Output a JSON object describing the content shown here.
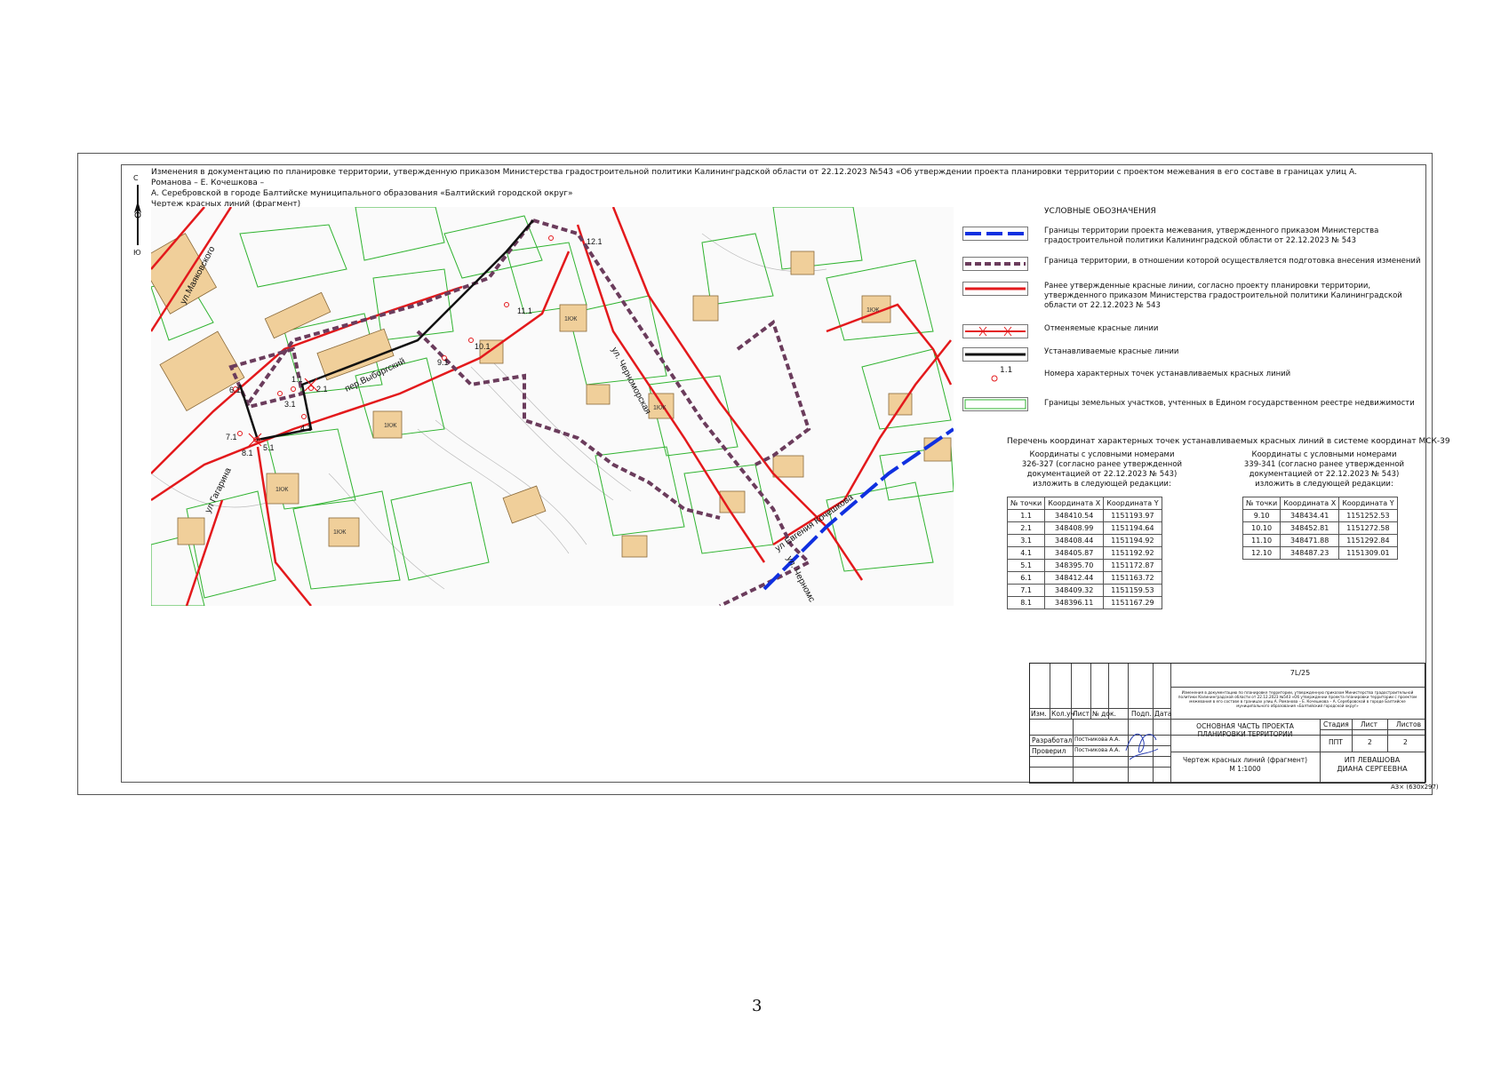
{
  "header": {
    "line1": "Изменения в документацию по планировке территории, утвержденную приказом Министерства градостроительной политики Калининградской области от 22.12.2023 №543 «Об утверждении проекта планировки территории с проектом межевания в его составе в границах улиц А. Романова – Е. Кочешкова –",
    "line2": "А. Серебровской в городе Балтийске муниципального образования «Балтийский городской округ»",
    "line3": "Чертеж красных линий (фрагмент)"
  },
  "compass": {
    "north": "С",
    "south": "Ю"
  },
  "map": {
    "streets": {
      "mayakovskogo": "ул.Маяковского",
      "vyborgsky": "пер.Выборгский",
      "chernomorskaya": "ул. Черноморская",
      "chernomorskaya2": "ул. Черномс",
      "gagarina": "ул Гагарина",
      "kocheshkova": "ул Евгения Кочешкова"
    },
    "points": [
      "1.1",
      "2.1",
      "3.1",
      "4.1",
      "5.1",
      "6.1",
      "7.1",
      "8.1",
      "9.1",
      "10.1",
      "11.1",
      "12.1"
    ],
    "building_label": "1КЖ",
    "colors": {
      "red_line": "#e3191c",
      "parcel": "#2fb32f",
      "boundary": "#6b3c5c",
      "building": "#f0cf9a",
      "blue": "#1030e0"
    }
  },
  "legend": {
    "title": "УСЛОВНЫЕ ОБОЗНАЧЕНИЯ",
    "items": [
      "Границы территории проекта межевания, утвержденного приказом Министерства градостроительной политики Калининградской области от 22.12.2023 № 543",
      "Граница территории, в отношении которой осуществляется подготовка внесения изменений",
      "Ранее утвержденные красные линии, согласно проекту планировки территории, утвержденного приказом Министерства градостроительной политики Калининградской области от 22.12.2023 № 543",
      "Отменяемые красные линии",
      "Устанавливаемые красные линии",
      "Номера характерных точек устанавливаемых красных линий",
      "Границы земельных участков, учтенных в Едином государственном реестре недвижимости"
    ],
    "point_sample": "1.1"
  },
  "coords": {
    "title": "Перечень координат характерных точек устанавливаемых красных линий в системе координат МСК-39",
    "block1": {
      "caption": [
        "Координаты с условными номерами",
        "326-327 (согласно ранее утвержденной",
        "документацией  от 22.12.2023 № 543)",
        "изложить в следующей редакции:"
      ],
      "headers": [
        "№ точки",
        "Координата X",
        "Координата Y"
      ],
      "rows": [
        [
          "1.1",
          "348410.54",
          "1151193.97"
        ],
        [
          "2.1",
          "348408.99",
          "1151194.64"
        ],
        [
          "3.1",
          "348408.44",
          "1151194.92"
        ],
        [
          "4.1",
          "348405.87",
          "1151192.92"
        ],
        [
          "5.1",
          "348395.70",
          "1151172.87"
        ],
        [
          "6.1",
          "348412.44",
          "1151163.72"
        ],
        [
          "7.1",
          "348409.32",
          "1151159.53"
        ],
        [
          "8.1",
          "348396.11",
          "1151167.29"
        ]
      ]
    },
    "block2": {
      "caption": [
        "Координаты с условными номерами",
        "339-341 (согласно ранее утвержденной",
        "документацией  от 22.12.2023 № 543)",
        "изложить в следующей редакции:"
      ],
      "headers": [
        "№ точки",
        "Координата X",
        "Координата Y"
      ],
      "rows": [
        [
          "9.10",
          "348434.41",
          "1151252.53"
        ],
        [
          "10.10",
          "348452.81",
          "1151272.58"
        ],
        [
          "11.10",
          "348471.88",
          "1151292.84"
        ],
        [
          "12.10",
          "348487.23",
          "1151309.01"
        ]
      ]
    }
  },
  "stamp": {
    "code": "7L/25",
    "desc": "Изменения в документацию по планировке территории, утвержденную приказом Министерства градостроительной политики Калининградской области от 22.12.2023 №543 «Об утверждении проекта планировки территории с проектом межевания в его составе в границах улиц А. Романова – Е. Кочешкова – А. Серебровской в городе Балтийске муниципального образования «Балтийский городской округ»",
    "cols": [
      "Изм.",
      "Кол.уч",
      "Лист",
      "№ док.",
      "Подп.",
      "Дата"
    ],
    "developed": "Разработал",
    "checked": "Проверил",
    "person": "Постникова А.А.",
    "section": "ОСНОВНАЯ ЧАСТЬ ПРОЕКТА ПЛАНИРОВКИ ТЕРРИТОРИИ",
    "stage_h": "Стадия",
    "sheet_h": "Лист",
    "sheets_h": "Листов",
    "stage": "ППТ",
    "sheet": "2",
    "sheets": "2",
    "drawing": "Чертеж красных линий (фрагмент)",
    "scale": "М 1:1000",
    "org1": "ИП ЛЕВАШОВА",
    "org2": "ДИАНА СЕРГЕЕВНА"
  },
  "format": "А3× (630х297)",
  "page_number": "3"
}
